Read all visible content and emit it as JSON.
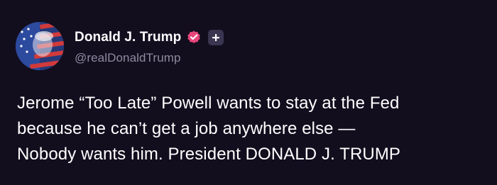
{
  "post": {
    "author": {
      "display_name": "Donald J. Trump",
      "handle": "@realDonaldTrump",
      "verified_icon": "verified-badge-icon",
      "follow_icon": "plus-icon",
      "badge_color": "#e8457a"
    },
    "body_lines": [
      "Jerome “Too Late” Powell wants to stay at the Fed",
      "because he can’t get a job anywhere else —",
      "Nobody wants him. President DONALD J. TRUMP"
    ]
  },
  "colors": {
    "background": "#120e1e",
    "text": "#ffffff",
    "handle": "#8f8aa0"
  }
}
